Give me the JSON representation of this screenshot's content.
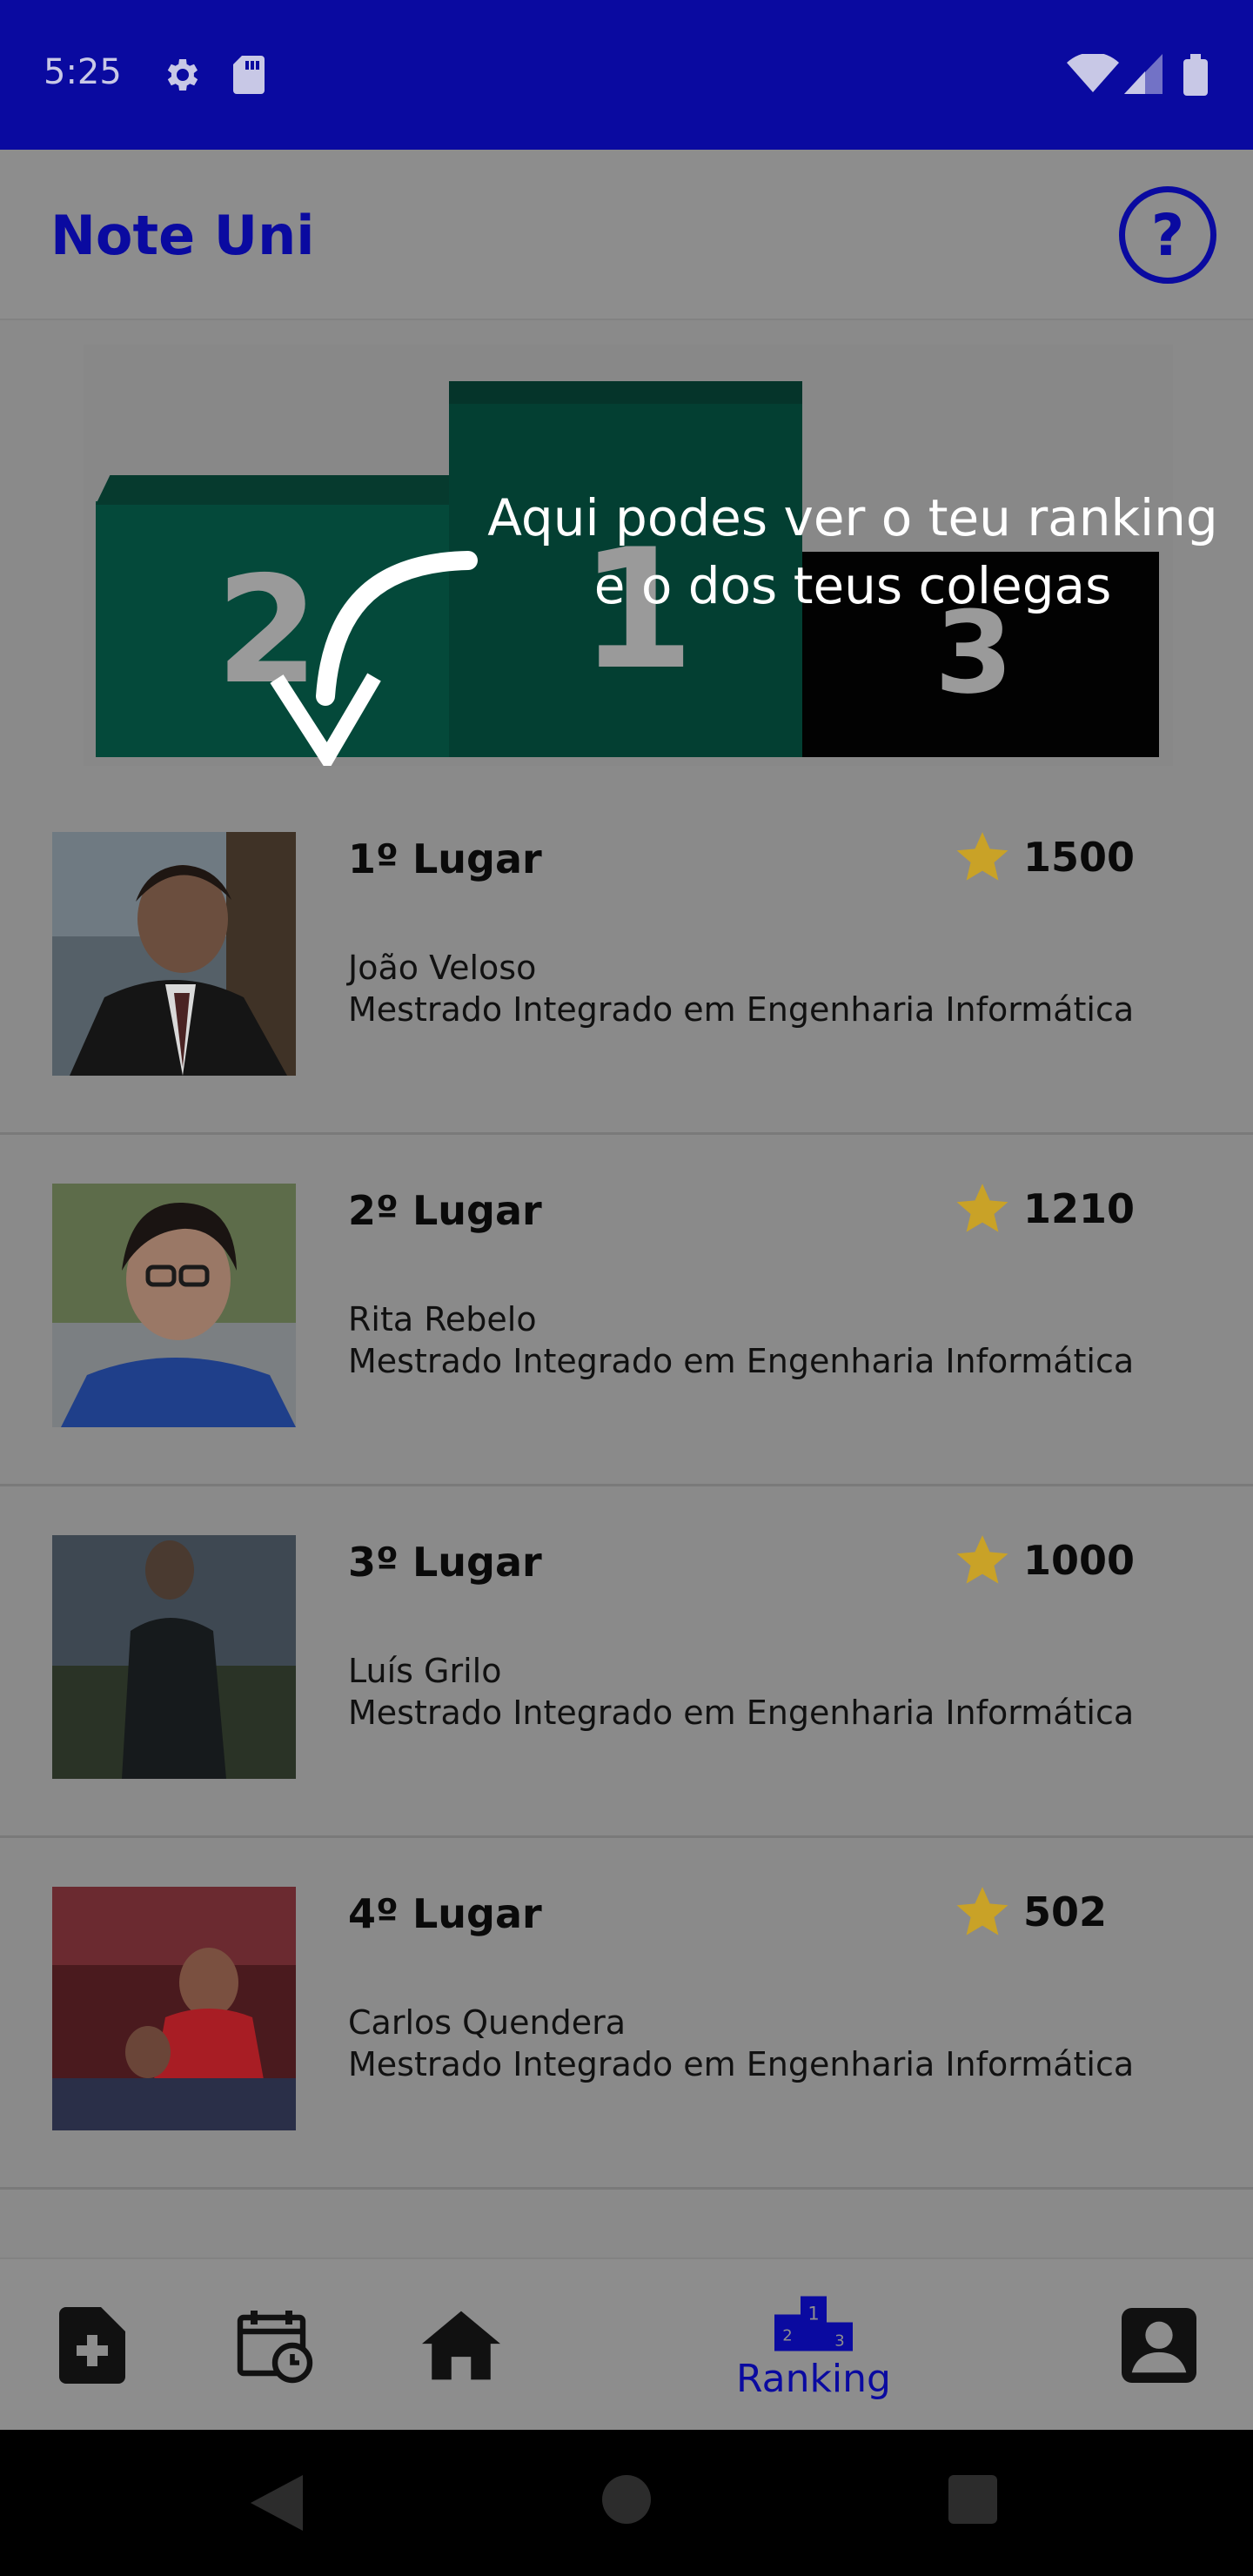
{
  "status_bar": {
    "time": "5:25",
    "icons": [
      "gear-icon",
      "sd-card-icon",
      "wifi-icon",
      "signal-icon",
      "battery-icon"
    ]
  },
  "app_bar": {
    "title": "Note Uni",
    "help_icon": "question-circle-icon",
    "help_glyph": "?"
  },
  "podium": {
    "places": [
      "2",
      "1",
      "3"
    ]
  },
  "tutorial": {
    "line1": "Aqui podes ver o teu ranking",
    "line2": "e o dos teus colegas"
  },
  "ranking": [
    {
      "place": "1º Lugar",
      "points": "1500",
      "name": "João Veloso",
      "course": "Mestrado Integrado em Engenharia Informática"
    },
    {
      "place": "2º Lugar",
      "points": "1210",
      "name": "Rita Rebelo",
      "course": "Mestrado Integrado em Engenharia Informática"
    },
    {
      "place": "3º Lugar",
      "points": "1000",
      "name": "Luís Grilo",
      "course": "Mestrado Integrado em Engenharia Informática"
    },
    {
      "place": "4º Lugar",
      "points": "502",
      "name": "Carlos Quendera",
      "course": "Mestrado Integrado em Engenharia Informática"
    }
  ],
  "bottom_nav": {
    "items": [
      {
        "icon": "add-document-icon",
        "label": ""
      },
      {
        "icon": "calendar-clock-icon",
        "label": ""
      },
      {
        "icon": "home-icon",
        "label": ""
      },
      {
        "icon": "podium-icon",
        "label": "Ranking"
      },
      {
        "icon": "profile-icon",
        "label": ""
      }
    ],
    "active": "Ranking"
  },
  "colors": {
    "brand": "#0a0aa0",
    "star": "#c9a227",
    "overlay_gray": "#8a8a8a"
  }
}
